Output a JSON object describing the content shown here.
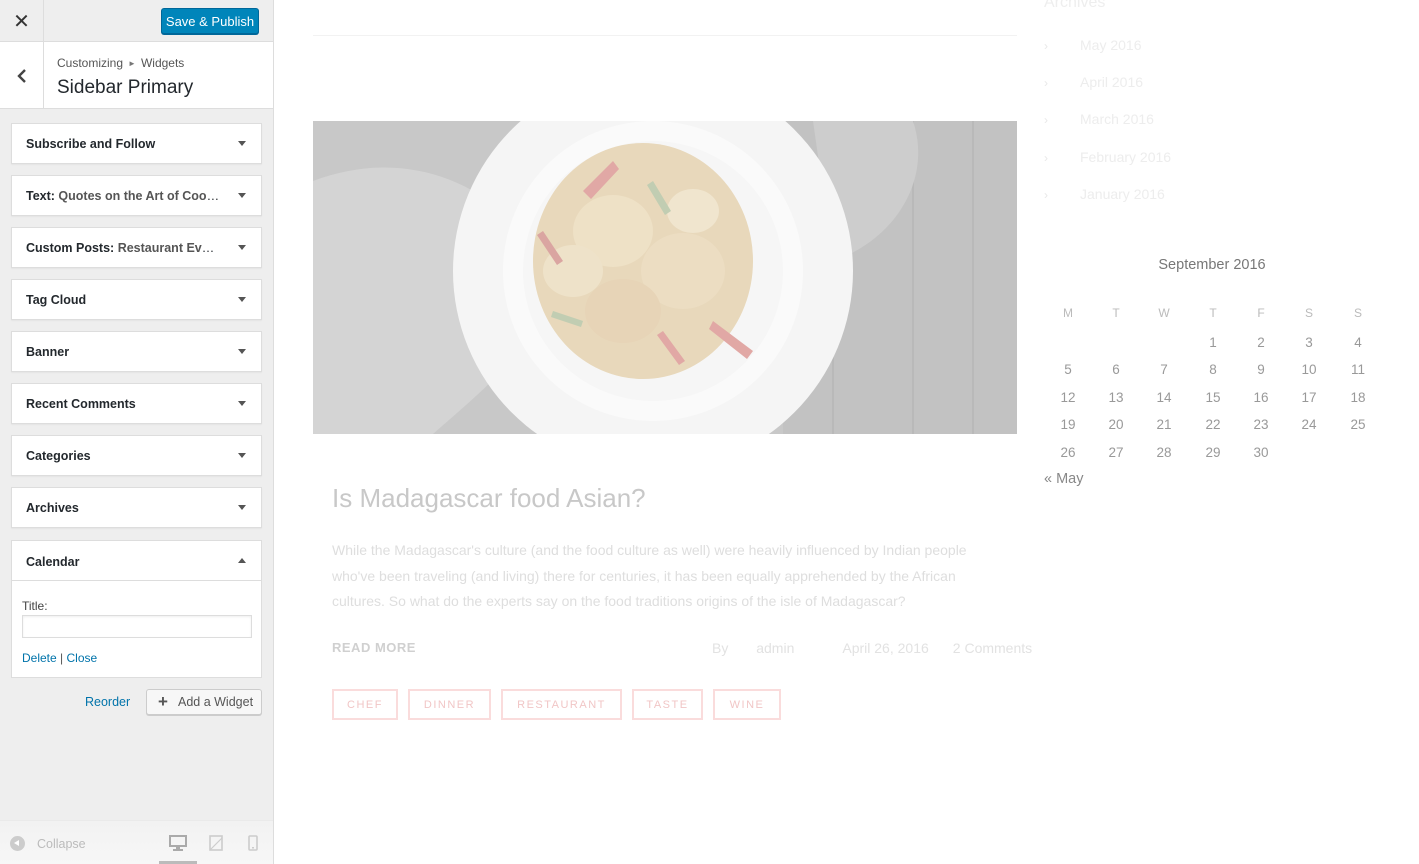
{
  "topbar": {
    "close_symbol": "✕",
    "save_label": "Save & Publish"
  },
  "section": {
    "crumb_parent": "Customizing",
    "crumb_child": "Widgets",
    "title": "Sidebar Primary"
  },
  "widgets": [
    {
      "name": "Subscribe and Follow",
      "subtitle": ""
    },
    {
      "name": "Text:",
      "subtitle": "Quotes on the Art of Cook..."
    },
    {
      "name": "Custom Posts:",
      "subtitle": "Restaurant Events"
    },
    {
      "name": "Tag Cloud",
      "subtitle": ""
    },
    {
      "name": "Banner",
      "subtitle": ""
    },
    {
      "name": "Recent Comments",
      "subtitle": ""
    },
    {
      "name": "Categories",
      "subtitle": ""
    },
    {
      "name": "Archives",
      "subtitle": ""
    }
  ],
  "calendar_widget": {
    "name": "Calendar",
    "title_label": "Title:",
    "title_value": "",
    "delete_label": "Delete",
    "separator": "|",
    "close_label": "Close"
  },
  "actions": {
    "reorder_label": "Reorder",
    "add_widget_label": "Add a Widget"
  },
  "footer": {
    "collapse_label": "Collapse",
    "active_device": "desktop"
  },
  "preview": {
    "post": {
      "title": "Is Madagascar food Asian?",
      "excerpt": "While the Madagascar's culture (and the food culture as well) were heavily influenced by Indian people who've been traveling (and living) there for centuries, it has been equally apprehended by the African cultures. So what do the experts say on the food traditions origins of the isle of Madagascar?",
      "read_more": "READ MORE",
      "author_prefix": "By",
      "author": "admin",
      "date": "April 26, 2016",
      "comments": "2 Comments",
      "tags": [
        "CHEF",
        "DINNER",
        "RESTAURANT",
        "TASTE",
        "WINE"
      ]
    },
    "archives": {
      "title": "Archives",
      "items": [
        "May 2016",
        "April 2016",
        "March 2016",
        "February 2016",
        "January 2016"
      ]
    },
    "calendar": {
      "caption": "September 2016",
      "weekdays": [
        "M",
        "T",
        "W",
        "T",
        "F",
        "S",
        "S"
      ],
      "weeks": [
        [
          "",
          "",
          "",
          "1",
          "2",
          "3",
          "4"
        ],
        [
          "5",
          "6",
          "7",
          "8",
          "9",
          "10",
          "11"
        ],
        [
          "12",
          "13",
          "14",
          "15",
          "16",
          "17",
          "18"
        ],
        [
          "19",
          "20",
          "21",
          "22",
          "23",
          "24",
          "25"
        ],
        [
          "26",
          "27",
          "28",
          "29",
          "30",
          "",
          ""
        ]
      ],
      "prev_link": "« May"
    }
  },
  "colors": {
    "primary_button": "#0085ba",
    "link": "#0073aa",
    "sidebar_bg": "#eeeeee",
    "tag_border": "#fadcdc"
  }
}
